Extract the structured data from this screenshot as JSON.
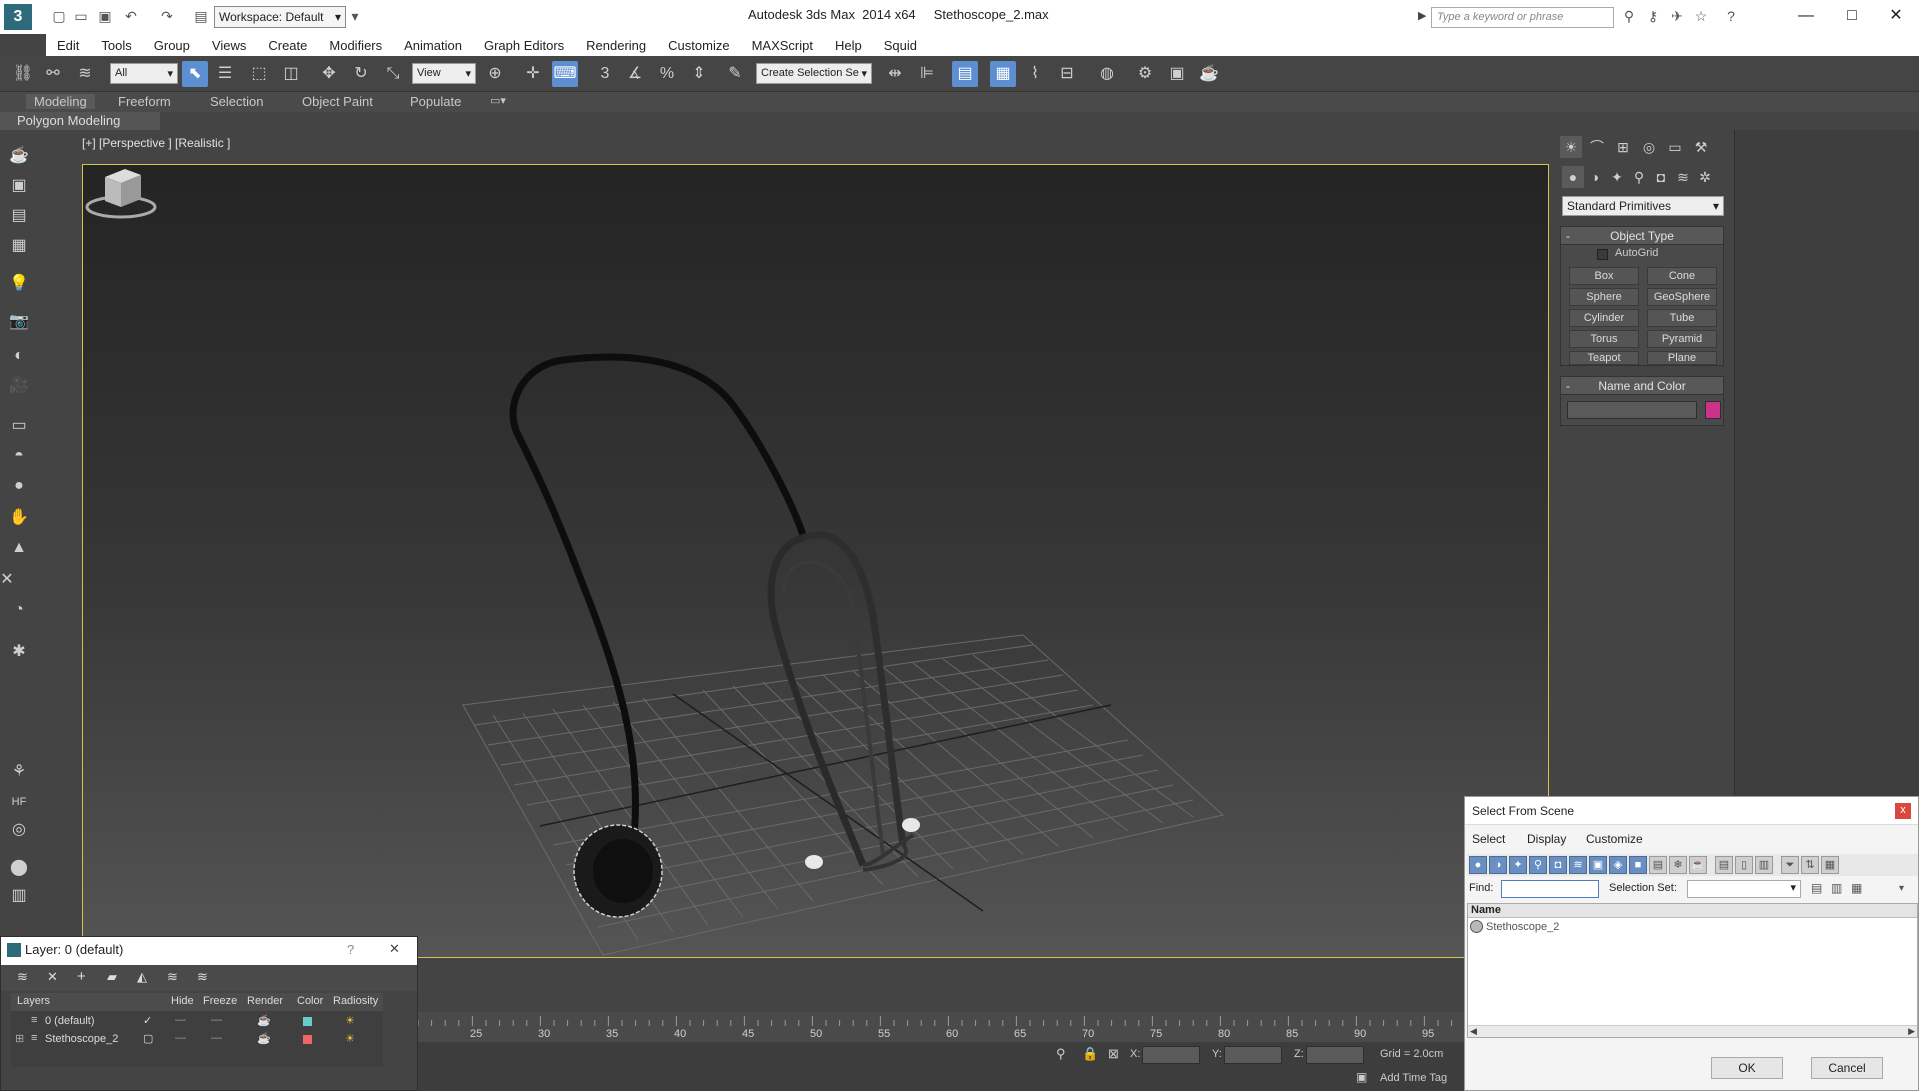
{
  "titlebar": {
    "workspace": "Workspace: Default",
    "title": "Autodesk 3ds Max  2014 x64     Stethoscope_2.max",
    "search_placeholder": "Type a keyword or phrase",
    "minimize": "—",
    "maximize": "□",
    "close": "✕"
  },
  "menubar": {
    "items": [
      "Edit",
      "Tools",
      "Group",
      "Views",
      "Create",
      "Modifiers",
      "Animation",
      "Graph Editors",
      "Rendering",
      "Customize",
      "MAXScript",
      "Help",
      "Squid"
    ]
  },
  "toolbar": {
    "selection_filter": "All",
    "reference_coord": "View",
    "named_selection": "Create Selection Se",
    "snap_value": "3",
    "angle_snap": "%"
  },
  "ribbon": {
    "tabs": [
      "Modeling",
      "Freeform",
      "Selection",
      "Object Paint",
      "Populate"
    ],
    "active_tab": "Modeling",
    "subpanel": "Polygon Modeling"
  },
  "viewport": {
    "label": "[+] [Perspective ] [Realistic ]"
  },
  "command_panel": {
    "category": "Standard Primitives",
    "object_type": {
      "title": "Object Type",
      "autogrid": "AutoGrid",
      "buttons": [
        "Box",
        "Cone",
        "Sphere",
        "GeoSphere",
        "Cylinder",
        "Tube",
        "Torus",
        "Pyramid",
        "Teapot",
        "Plane"
      ]
    },
    "name_and_color": {
      "title": "Name and Color",
      "name_value": "",
      "color": "#cc3388"
    }
  },
  "layer_manager": {
    "title": "Layer: 0 (default)",
    "help": "?",
    "close": "✕",
    "columns": [
      "Layers",
      "Hide",
      "Freeze",
      "Render",
      "Color",
      "Radiosity"
    ],
    "rows": [
      {
        "name": "0 (default)",
        "color": "#66cccc"
      },
      {
        "name": "Stethoscope_2",
        "color": "#ee6666"
      }
    ]
  },
  "timeline": {
    "ticks": [
      "25",
      "30",
      "35",
      "40",
      "45",
      "50",
      "55",
      "60",
      "65",
      "70",
      "75",
      "80",
      "85",
      "90",
      "95"
    ]
  },
  "statusbar": {
    "x_label": "X:",
    "y_label": "Y:",
    "z_label": "Z:",
    "grid": "Grid = 2.0cm",
    "add_time_tag": "Add Time Tag"
  },
  "select_from_scene": {
    "title": "Select From Scene",
    "close": "x",
    "menu": [
      "Select",
      "Display",
      "Customize"
    ],
    "find_label": "Find:",
    "find_value": "",
    "selection_set_label": "Selection Set:",
    "column_name": "Name",
    "items": [
      "Stethoscope_2"
    ],
    "ok": "OK",
    "cancel": "Cancel"
  }
}
